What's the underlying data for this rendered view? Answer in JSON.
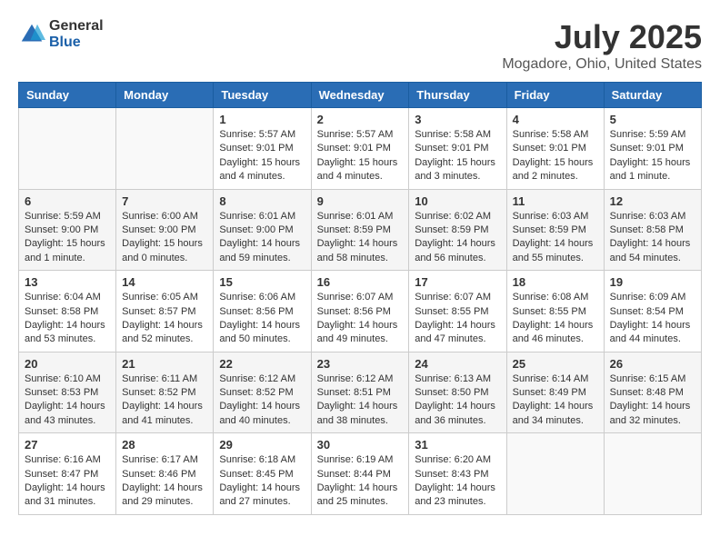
{
  "logo": {
    "general": "General",
    "blue": "Blue"
  },
  "title": "July 2025",
  "location": "Mogadore, Ohio, United States",
  "days_of_week": [
    "Sunday",
    "Monday",
    "Tuesday",
    "Wednesday",
    "Thursday",
    "Friday",
    "Saturday"
  ],
  "weeks": [
    [
      {
        "day": "",
        "info": ""
      },
      {
        "day": "",
        "info": ""
      },
      {
        "day": "1",
        "info": "Sunrise: 5:57 AM\nSunset: 9:01 PM\nDaylight: 15 hours and 4 minutes."
      },
      {
        "day": "2",
        "info": "Sunrise: 5:57 AM\nSunset: 9:01 PM\nDaylight: 15 hours and 4 minutes."
      },
      {
        "day": "3",
        "info": "Sunrise: 5:58 AM\nSunset: 9:01 PM\nDaylight: 15 hours and 3 minutes."
      },
      {
        "day": "4",
        "info": "Sunrise: 5:58 AM\nSunset: 9:01 PM\nDaylight: 15 hours and 2 minutes."
      },
      {
        "day": "5",
        "info": "Sunrise: 5:59 AM\nSunset: 9:01 PM\nDaylight: 15 hours and 1 minute."
      }
    ],
    [
      {
        "day": "6",
        "info": "Sunrise: 5:59 AM\nSunset: 9:00 PM\nDaylight: 15 hours and 1 minute."
      },
      {
        "day": "7",
        "info": "Sunrise: 6:00 AM\nSunset: 9:00 PM\nDaylight: 15 hours and 0 minutes."
      },
      {
        "day": "8",
        "info": "Sunrise: 6:01 AM\nSunset: 9:00 PM\nDaylight: 14 hours and 59 minutes."
      },
      {
        "day": "9",
        "info": "Sunrise: 6:01 AM\nSunset: 8:59 PM\nDaylight: 14 hours and 58 minutes."
      },
      {
        "day": "10",
        "info": "Sunrise: 6:02 AM\nSunset: 8:59 PM\nDaylight: 14 hours and 56 minutes."
      },
      {
        "day": "11",
        "info": "Sunrise: 6:03 AM\nSunset: 8:59 PM\nDaylight: 14 hours and 55 minutes."
      },
      {
        "day": "12",
        "info": "Sunrise: 6:03 AM\nSunset: 8:58 PM\nDaylight: 14 hours and 54 minutes."
      }
    ],
    [
      {
        "day": "13",
        "info": "Sunrise: 6:04 AM\nSunset: 8:58 PM\nDaylight: 14 hours and 53 minutes."
      },
      {
        "day": "14",
        "info": "Sunrise: 6:05 AM\nSunset: 8:57 PM\nDaylight: 14 hours and 52 minutes."
      },
      {
        "day": "15",
        "info": "Sunrise: 6:06 AM\nSunset: 8:56 PM\nDaylight: 14 hours and 50 minutes."
      },
      {
        "day": "16",
        "info": "Sunrise: 6:07 AM\nSunset: 8:56 PM\nDaylight: 14 hours and 49 minutes."
      },
      {
        "day": "17",
        "info": "Sunrise: 6:07 AM\nSunset: 8:55 PM\nDaylight: 14 hours and 47 minutes."
      },
      {
        "day": "18",
        "info": "Sunrise: 6:08 AM\nSunset: 8:55 PM\nDaylight: 14 hours and 46 minutes."
      },
      {
        "day": "19",
        "info": "Sunrise: 6:09 AM\nSunset: 8:54 PM\nDaylight: 14 hours and 44 minutes."
      }
    ],
    [
      {
        "day": "20",
        "info": "Sunrise: 6:10 AM\nSunset: 8:53 PM\nDaylight: 14 hours and 43 minutes."
      },
      {
        "day": "21",
        "info": "Sunrise: 6:11 AM\nSunset: 8:52 PM\nDaylight: 14 hours and 41 minutes."
      },
      {
        "day": "22",
        "info": "Sunrise: 6:12 AM\nSunset: 8:52 PM\nDaylight: 14 hours and 40 minutes."
      },
      {
        "day": "23",
        "info": "Sunrise: 6:12 AM\nSunset: 8:51 PM\nDaylight: 14 hours and 38 minutes."
      },
      {
        "day": "24",
        "info": "Sunrise: 6:13 AM\nSunset: 8:50 PM\nDaylight: 14 hours and 36 minutes."
      },
      {
        "day": "25",
        "info": "Sunrise: 6:14 AM\nSunset: 8:49 PM\nDaylight: 14 hours and 34 minutes."
      },
      {
        "day": "26",
        "info": "Sunrise: 6:15 AM\nSunset: 8:48 PM\nDaylight: 14 hours and 32 minutes."
      }
    ],
    [
      {
        "day": "27",
        "info": "Sunrise: 6:16 AM\nSunset: 8:47 PM\nDaylight: 14 hours and 31 minutes."
      },
      {
        "day": "28",
        "info": "Sunrise: 6:17 AM\nSunset: 8:46 PM\nDaylight: 14 hours and 29 minutes."
      },
      {
        "day": "29",
        "info": "Sunrise: 6:18 AM\nSunset: 8:45 PM\nDaylight: 14 hours and 27 minutes."
      },
      {
        "day": "30",
        "info": "Sunrise: 6:19 AM\nSunset: 8:44 PM\nDaylight: 14 hours and 25 minutes."
      },
      {
        "day": "31",
        "info": "Sunrise: 6:20 AM\nSunset: 8:43 PM\nDaylight: 14 hours and 23 minutes."
      },
      {
        "day": "",
        "info": ""
      },
      {
        "day": "",
        "info": ""
      }
    ]
  ]
}
